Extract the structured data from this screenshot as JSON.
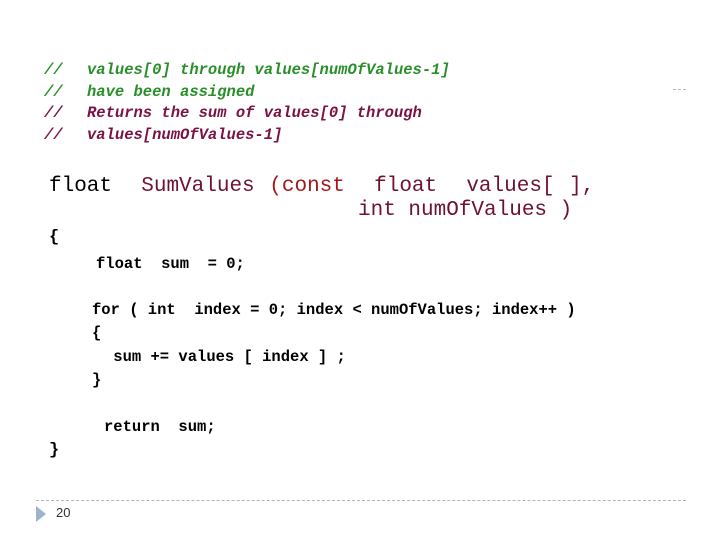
{
  "comments": [
    {
      "prefix": "//",
      "text": "values[0] through values[numOfValues-1]",
      "color": "#2a8f2a"
    },
    {
      "prefix": "//",
      "text": "have been assigned",
      "color": "#2a8f2a"
    },
    {
      "prefix": "//",
      "text": "Returns the sum of values[0] through",
      "color": "#7a1244"
    },
    {
      "prefix": "//",
      "text": "values[numOfValues-1]",
      "color": "#7a1244"
    }
  ],
  "signature": {
    "return_type": "float",
    "function_name": "SumValues",
    "open_paren_const": "(const",
    "param1": "float  values[ ],",
    "param2": "int numOfValues )"
  },
  "body": {
    "open_brace": "{",
    "declaration": "float  sum  = 0;",
    "for_header": "for ( int  index = 0; index < numOfValues; index++ )",
    "for_open": "{",
    "accumulate": " sum += values [ index ] ;",
    "for_close": "}",
    "return_stmt": "return  sum;",
    "close_brace": "}"
  },
  "footer": {
    "page_number": "20",
    "bullet_icon": "triangle-right-icon",
    "accent_color": "#9fb4cc"
  },
  "colors": {
    "comment_green": "#2a8f2a",
    "comment_maroon": "#7a1244",
    "identifier_maroon": "#6e1232",
    "keyword_red": "#a3181c",
    "code_black": "#000000"
  }
}
